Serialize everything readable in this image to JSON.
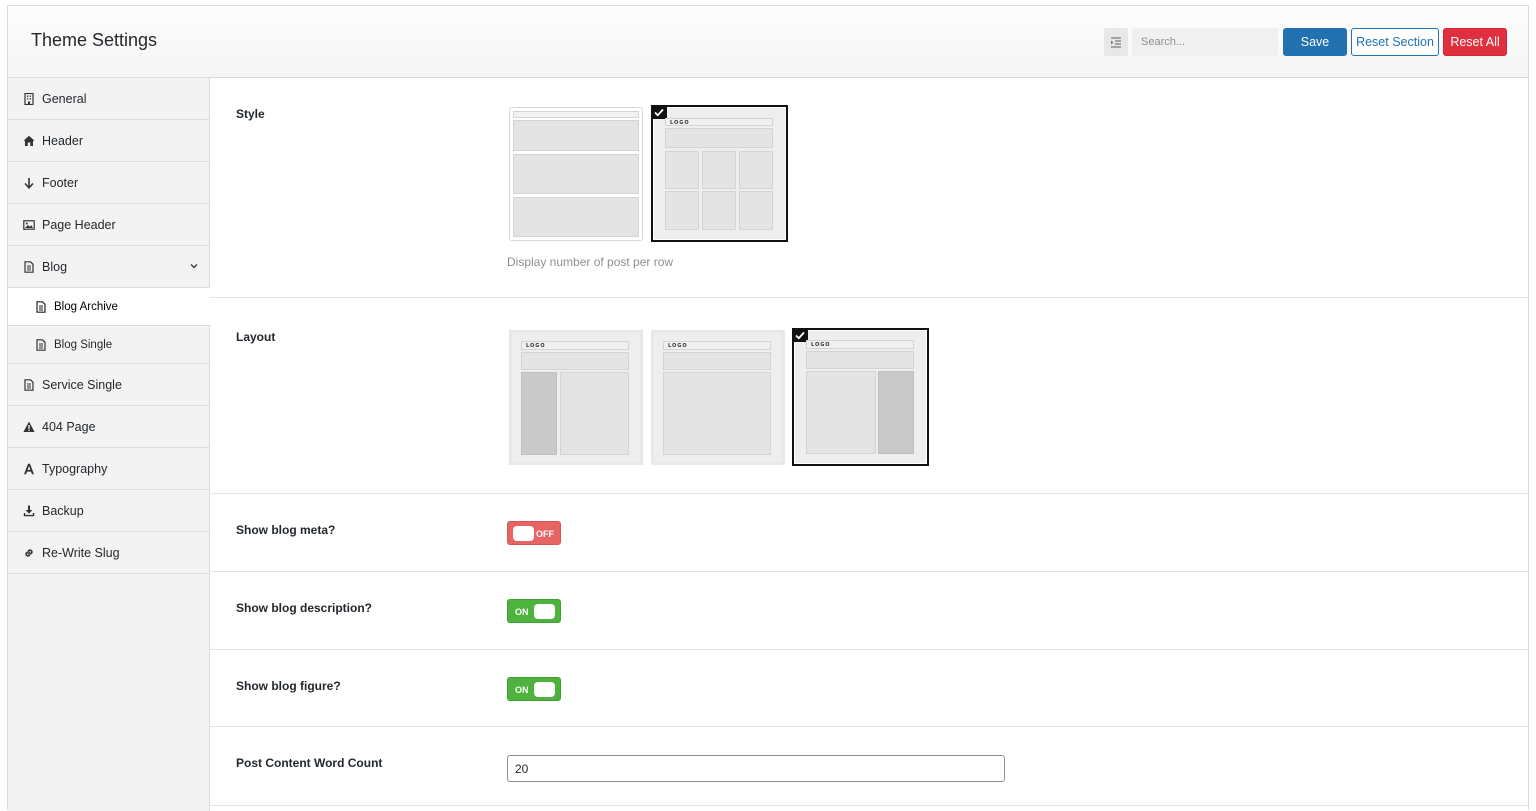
{
  "header": {
    "title": "Theme Settings",
    "search_placeholder": "Search...",
    "save_label": "Save",
    "reset_section_label": "Reset Section",
    "reset_all_label": "Reset All"
  },
  "sidebar": {
    "items": [
      {
        "label": "General",
        "icon": "building-icon"
      },
      {
        "label": "Header",
        "icon": "home-icon"
      },
      {
        "label": "Footer",
        "icon": "arrow-down-icon"
      },
      {
        "label": "Page Header",
        "icon": "image-icon"
      },
      {
        "label": "Blog",
        "icon": "document-icon",
        "expanded": true,
        "children": [
          {
            "label": "Blog Archive",
            "icon": "document-icon",
            "active": true
          },
          {
            "label": "Blog Single",
            "icon": "document-icon"
          }
        ]
      },
      {
        "label": "Service Single",
        "icon": "document-icon"
      },
      {
        "label": "404 Page",
        "icon": "warning-icon"
      },
      {
        "label": "Typography",
        "icon": "font-icon"
      },
      {
        "label": "Backup",
        "icon": "download-icon"
      },
      {
        "label": "Re-Write Slug",
        "icon": "link-icon"
      }
    ]
  },
  "settings": {
    "style": {
      "label": "Style",
      "description": "Display number of post per row",
      "options": [
        "one-column",
        "three-columns"
      ],
      "selected": "three-columns"
    },
    "layout": {
      "label": "Layout",
      "options": [
        "left-sidebar",
        "no-sidebar",
        "right-sidebar"
      ],
      "selected": "right-sidebar",
      "logo_text": "LOGO"
    },
    "show_meta": {
      "label": "Show blog meta?",
      "state": "OFF"
    },
    "show_description": {
      "label": "Show blog description?",
      "state": "ON"
    },
    "show_figure": {
      "label": "Show blog figure?",
      "state": "ON"
    },
    "word_count": {
      "label": "Post Content Word Count",
      "value": "20"
    }
  },
  "colors": {
    "primary": "#2271b1",
    "danger": "#e0303f",
    "toggle_on": "#4db33d",
    "toggle_off": "#e86464"
  }
}
